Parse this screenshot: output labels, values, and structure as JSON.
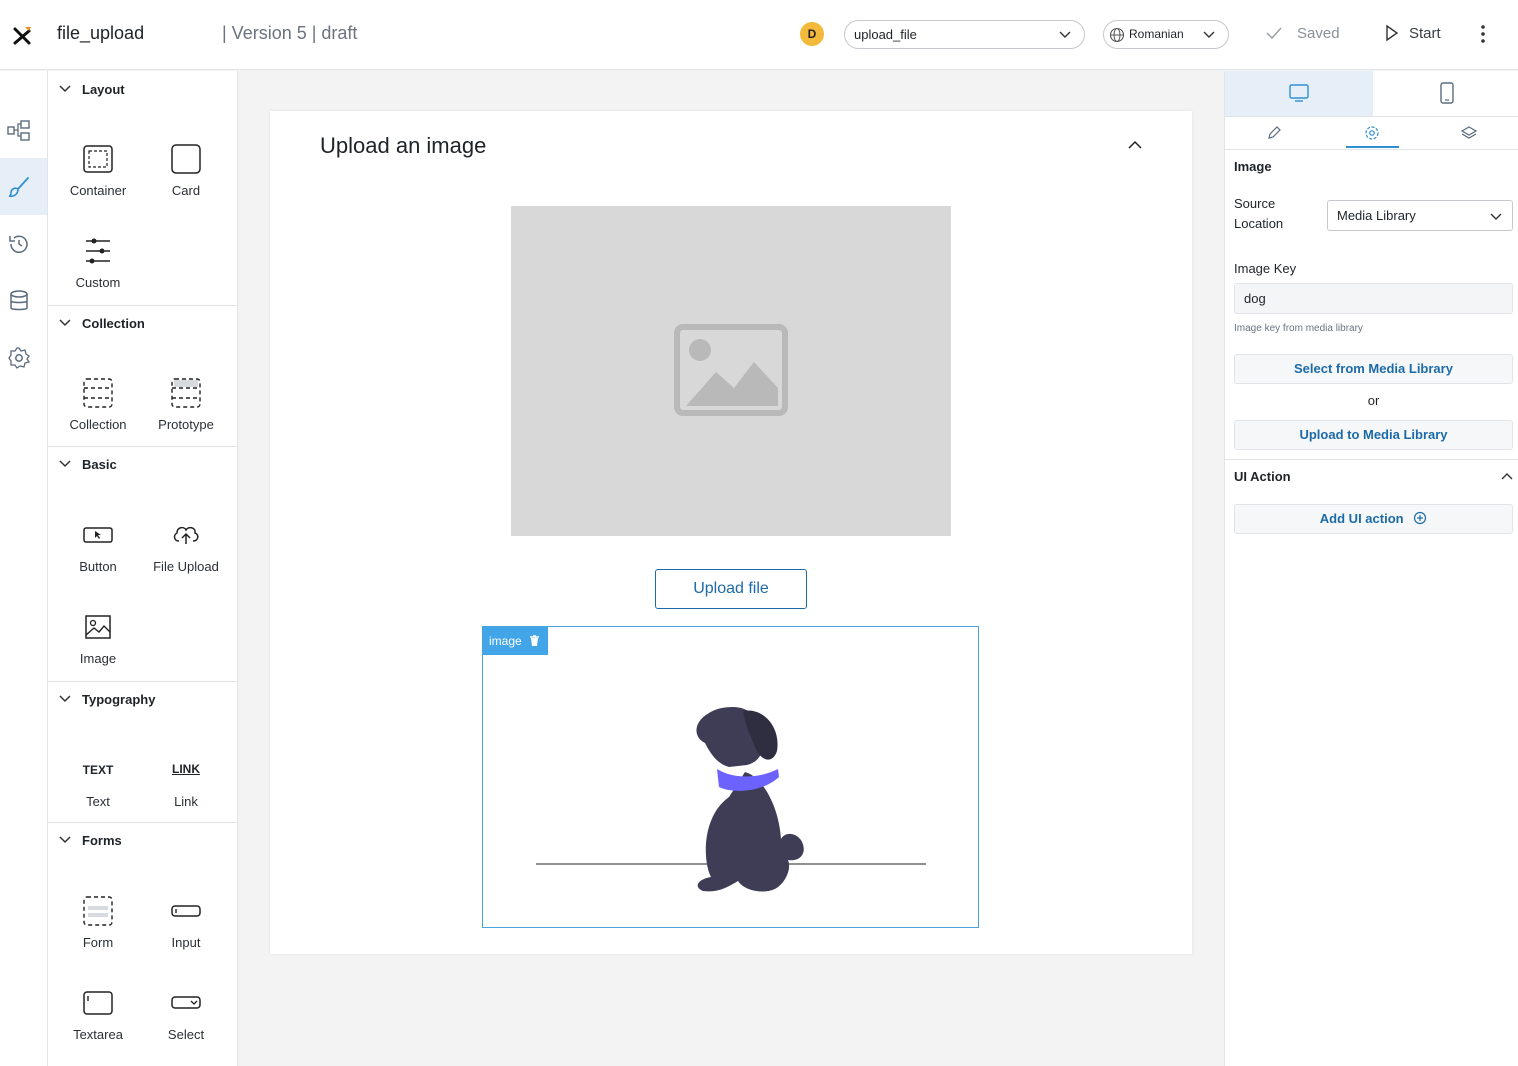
{
  "topbar": {
    "app_name": "file_upload",
    "version": "| Version 5 | draft",
    "avatar_initial": "D",
    "process_select": "upload_file",
    "language_select": "Romanian",
    "saved_label": "Saved",
    "start_label": "Start"
  },
  "palette": {
    "sections": [
      {
        "title": "Layout",
        "items": [
          "Container",
          "Card",
          "Custom"
        ]
      },
      {
        "title": "Collection",
        "items": [
          "Collection",
          "Prototype"
        ]
      },
      {
        "title": "Basic",
        "items": [
          "Button",
          "File Upload",
          "Image"
        ]
      },
      {
        "title": "Typography",
        "items": [
          "Text",
          "Link"
        ]
      },
      {
        "title": "Forms",
        "items": [
          "Form",
          "Input",
          "Textarea",
          "Select"
        ]
      }
    ],
    "typo_glyphs": {
      "text": "TEXT",
      "link": "LINK"
    }
  },
  "canvas": {
    "card_title": "Upload an image",
    "upload_button": "Upload file",
    "image_tag": "image"
  },
  "props": {
    "section_title": "Image",
    "source_location_label": "Source Location",
    "source_location_value": "Media Library",
    "image_key_label": "Image Key",
    "image_key_value": "dog",
    "image_key_hint": "Image key from media library",
    "select_button": "Select from Media Library",
    "or_text": "or",
    "upload_button": "Upload to Media Library",
    "ui_action_title": "UI Action",
    "add_ui_action": "Add UI action"
  },
  "colors": {
    "accent": "#1c6ba8",
    "selection": "#42a5e8",
    "avatar": "#f3b93a",
    "dog_collar": "#6c63ff",
    "dog_body": "#3f3d56"
  }
}
